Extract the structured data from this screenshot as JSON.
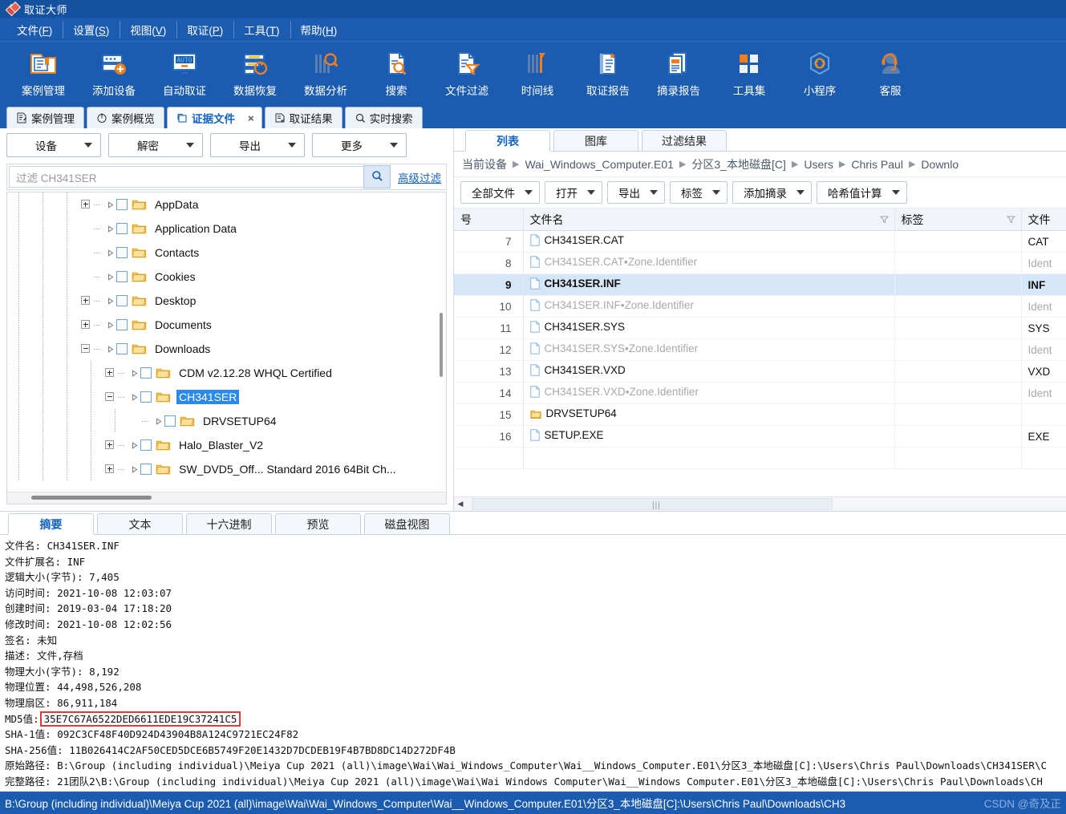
{
  "app": {
    "title": "取证大师",
    "logo_icon": "diamond-logo-icon"
  },
  "menubar": [
    {
      "label": "文件",
      "accel": "F"
    },
    {
      "label": "设置",
      "accel": "S"
    },
    {
      "label": "视图",
      "accel": "V"
    },
    {
      "label": "取证",
      "accel": "P"
    },
    {
      "label": "工具",
      "accel": "T"
    },
    {
      "label": "帮助",
      "accel": "H"
    }
  ],
  "toolbar": [
    {
      "label": "案例管理",
      "icon": "case-folder-icon"
    },
    {
      "label": "添加设备",
      "icon": "add-device-icon"
    },
    {
      "label": "自动取证",
      "icon": "auto-forensics-icon"
    },
    {
      "label": "数据恢复",
      "icon": "data-recovery-icon"
    },
    {
      "label": "数据分析",
      "icon": "data-analysis-icon"
    },
    {
      "label": "搜索",
      "icon": "search-doc-icon"
    },
    {
      "label": "文件过滤",
      "icon": "file-filter-icon"
    },
    {
      "label": "时间线",
      "icon": "timeline-icon"
    },
    {
      "label": "取证报告",
      "icon": "forensics-report-icon"
    },
    {
      "label": "摘录报告",
      "icon": "excerpt-report-icon"
    },
    {
      "label": "工具集",
      "icon": "toolset-icon"
    },
    {
      "label": "小程序",
      "icon": "miniapp-icon"
    },
    {
      "label": "客服",
      "icon": "support-icon"
    }
  ],
  "main_tabs": [
    {
      "label": "案例管理",
      "icon": "case-manage-icon",
      "active": false,
      "closable": false
    },
    {
      "label": "案例概览",
      "icon": "case-overview-icon",
      "active": false,
      "closable": false
    },
    {
      "label": "证据文件",
      "icon": "evidence-file-icon",
      "active": true,
      "closable": true,
      "close_label": "×"
    },
    {
      "label": "取证结果",
      "icon": "forensics-result-icon",
      "active": false,
      "closable": false
    },
    {
      "label": "实时搜索",
      "icon": "live-search-icon",
      "active": false,
      "closable": false
    }
  ],
  "left_panel": {
    "buttons": [
      {
        "label": "设备"
      },
      {
        "label": "解密"
      },
      {
        "label": "导出"
      },
      {
        "label": "更多"
      }
    ],
    "filter": {
      "value": "过滤 CH341SER",
      "placeholder": "过滤 CH341SER",
      "search_icon": "magnifier-icon",
      "advanced_label": "高级过滤"
    },
    "tree": [
      {
        "label": "AppData",
        "depth": 4,
        "expander": "plus",
        "selected": false
      },
      {
        "label": "Application Data",
        "depth": 4,
        "expander": "none",
        "selected": false
      },
      {
        "label": "Contacts",
        "depth": 4,
        "expander": "none",
        "selected": false
      },
      {
        "label": "Cookies",
        "depth": 4,
        "expander": "none",
        "selected": false
      },
      {
        "label": "Desktop",
        "depth": 4,
        "expander": "plus",
        "selected": false
      },
      {
        "label": "Documents",
        "depth": 4,
        "expander": "plus",
        "selected": false
      },
      {
        "label": "Downloads",
        "depth": 4,
        "expander": "minus",
        "selected": false
      },
      {
        "label": "CDM v2.12.28 WHQL Certified",
        "depth": 5,
        "expander": "plus",
        "selected": false
      },
      {
        "label": "CH341SER",
        "depth": 5,
        "expander": "minus",
        "selected": true
      },
      {
        "label": "DRVSETUP64",
        "depth": 6,
        "expander": "none",
        "selected": false
      },
      {
        "label": "Halo_Blaster_V2",
        "depth": 5,
        "expander": "plus",
        "selected": false
      },
      {
        "label": "SW_DVD5_Off...   Standard 2016 64Bit Ch...",
        "depth": 5,
        "expander": "plus",
        "selected": false
      }
    ]
  },
  "right_panel": {
    "tabs": [
      {
        "label": "列表",
        "active": true
      },
      {
        "label": "图库",
        "active": false
      },
      {
        "label": "过滤结果",
        "active": false
      }
    ],
    "breadcrumb": [
      "当前设备",
      "Wai_Windows_Computer.E01",
      "分区3_本地磁盘[C]",
      "Users",
      "Chris Paul",
      "Downlo"
    ],
    "buttons": [
      {
        "label": "全部文件"
      },
      {
        "label": "打开"
      },
      {
        "label": "导出"
      },
      {
        "label": "标签"
      },
      {
        "label": "添加摘录"
      },
      {
        "label": "哈希值计算"
      }
    ],
    "table": {
      "columns": [
        "号",
        "文件名",
        "标签",
        "文件"
      ],
      "rows": [
        {
          "num": "7",
          "name": "CH341SER.CAT",
          "tag": "",
          "type": "CAT",
          "icon": "file-icon",
          "dim": false,
          "selected": false
        },
        {
          "num": "8",
          "name": "CH341SER.CAT▪Zone.Identifier",
          "tag": "",
          "type": "Ident",
          "icon": "file-icon",
          "dim": true,
          "selected": false
        },
        {
          "num": "9",
          "name": "CH341SER.INF",
          "tag": "",
          "type": "INF",
          "icon": "file-icon",
          "dim": false,
          "selected": true
        },
        {
          "num": "10",
          "name": "CH341SER.INF▪Zone.Identifier",
          "tag": "",
          "type": "Ident",
          "icon": "file-icon",
          "dim": true,
          "selected": false
        },
        {
          "num": "11",
          "name": "CH341SER.SYS",
          "tag": "",
          "type": "SYS",
          "icon": "file-icon",
          "dim": false,
          "selected": false
        },
        {
          "num": "12",
          "name": "CH341SER.SYS▪Zone.Identifier",
          "tag": "",
          "type": "Ident",
          "icon": "file-icon",
          "dim": true,
          "selected": false
        },
        {
          "num": "13",
          "name": "CH341SER.VXD",
          "tag": "",
          "type": "VXD",
          "icon": "file-icon",
          "dim": false,
          "selected": false
        },
        {
          "num": "14",
          "name": "CH341SER.VXD▪Zone.Identifier",
          "tag": "",
          "type": "Ident",
          "icon": "file-icon",
          "dim": true,
          "selected": false
        },
        {
          "num": "15",
          "name": "DRVSETUP64",
          "tag": "",
          "type": "",
          "icon": "folder-icon",
          "dim": false,
          "selected": false
        },
        {
          "num": "16",
          "name": "SETUP.EXE",
          "tag": "",
          "type": "EXE",
          "icon": "file-icon",
          "dim": false,
          "selected": false
        }
      ]
    }
  },
  "detail_panel": {
    "tabs": [
      {
        "label": "摘要",
        "active": true
      },
      {
        "label": "文本",
        "active": false
      },
      {
        "label": "十六进制",
        "active": false
      },
      {
        "label": "预览",
        "active": false
      },
      {
        "label": "磁盘视图",
        "active": false
      }
    ],
    "summary": {
      "filename": {
        "key": "文件名:",
        "value": "CH341SER.INF"
      },
      "extension": {
        "key": "文件扩展名:",
        "value": "INF"
      },
      "logical_size": {
        "key": "逻辑大小(字节):",
        "value": "7,405"
      },
      "accessed": {
        "key": "访问时间:",
        "value": "2021-10-08 12:03:07"
      },
      "created": {
        "key": "创建时间:",
        "value": "2019-03-04 17:18:20"
      },
      "modified": {
        "key": "修改时间:",
        "value": "2021-10-08 12:02:56"
      },
      "signature": {
        "key": "签名:",
        "value": "未知"
      },
      "description": {
        "key": "描述:",
        "value": "文件,存档"
      },
      "physical_size": {
        "key": "物理大小(字节):",
        "value": "8,192"
      },
      "physical_offset": {
        "key": "物理位置:",
        "value": "44,498,526,208"
      },
      "physical_sector": {
        "key": "物理扇区:",
        "value": "86,911,184"
      },
      "md5": {
        "key": "MD5值:",
        "value": "35E7C67A6522DED6611EDE19C37241C5",
        "highlight_color": "#e53935"
      },
      "sha1": {
        "key": "SHA-1值:",
        "value": "092C3CF48F40D924D43904B8A124C9721EC24F82"
      },
      "sha256": {
        "key": "SHA-256值:",
        "value": "11B026414C2AF50CED5DCE6B5749F20E1432D7DCDEB19F4B7BD8DC14D272DF4B"
      },
      "orig_path": {
        "key": "原始路径:",
        "value": "B:\\Group (including individual)\\Meiya Cup 2021 (all)\\image\\Wai\\Wai_Windows_Computer\\Wai__Windows_Computer.E01\\分区3_本地磁盘[C]:\\Users\\Chris Paul\\Downloads\\CH341SER\\C"
      },
      "full_path": {
        "key": "完整路径:",
        "value": "21团队2\\B:\\Group (including individual)\\Meiya Cup 2021 (all)\\image\\Wai\\Wai Windows Computer\\Wai__Windows Computer.E01\\分区3_本地磁盘[C]:\\Users\\Chris Paul\\Downloads\\CH"
      }
    }
  },
  "statusbar": {
    "path": "B:\\Group (including individual)\\Meiya Cup 2021 (all)\\image\\Wai\\Wai_Windows_Computer\\Wai__Windows_Computer.E01\\分区3_本地磁盘[C]:\\Users\\Chris Paul\\Downloads\\CH3",
    "watermark": "CSDN @奇及正"
  },
  "colors": {
    "chrome_blue": "#1b5bb0",
    "title_blue": "#1452a0",
    "accent_link": "#1263c4",
    "selection_blue": "#2a8aea",
    "row_selection": "#d5e6f8",
    "highlight_red": "#e53935",
    "folder_yellow": "#f5c040"
  }
}
